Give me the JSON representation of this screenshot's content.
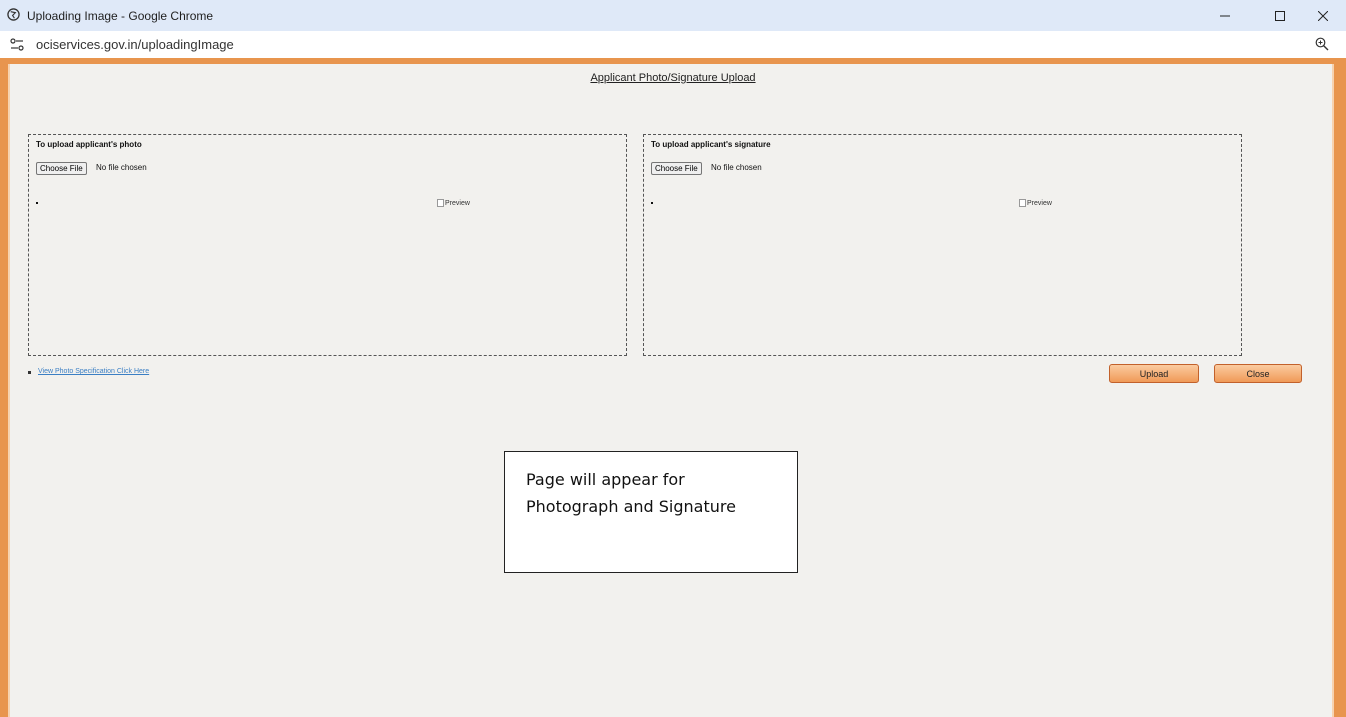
{
  "window": {
    "title": "Uploading Image - Google Chrome",
    "url": "ociservices.gov.in/uploadingImage"
  },
  "page": {
    "heading": "Applicant Photo/Signature Upload",
    "photo_box": {
      "title": "To upload applicant's photo",
      "choose_label": "Choose File",
      "file_status": "No file chosen",
      "preview_alt": "Preview"
    },
    "signature_box": {
      "title": "To upload applicant's signature",
      "choose_label": "Choose File",
      "file_status": "No file chosen",
      "preview_alt": "Preview"
    },
    "spec_link": "View Photo Specification Click Here",
    "upload_label": "Upload",
    "close_label": "Close"
  },
  "note": {
    "text": "Page will appear for Photograph and Signature"
  },
  "colors": {
    "frame": "#e8954e",
    "titlebar": "#dfe9f8",
    "link": "#3b7fc4",
    "button": "#f09a58"
  }
}
